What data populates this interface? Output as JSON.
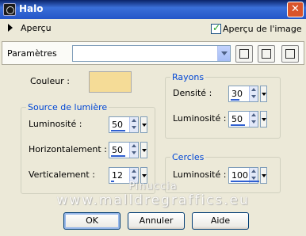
{
  "window": {
    "title": "Halo",
    "close_label": "✕"
  },
  "preview": {
    "label": "Aperçu",
    "image_preview_label": "Aperçu de l'image",
    "image_preview_checked": true
  },
  "params": {
    "label": "Paramètres",
    "preset_value": ""
  },
  "colour": {
    "label": "Couleur :",
    "value": "#f5dc97"
  },
  "light_source": {
    "legend": "Source de lumière",
    "brightness": {
      "label": "Luminosité :",
      "value": "50"
    },
    "horizontal": {
      "label": "Horizontalement :",
      "value": "50"
    },
    "vertical": {
      "label": "Verticalement :",
      "value": "12"
    }
  },
  "rays": {
    "legend": "Rayons",
    "density": {
      "label": "Densité :",
      "value": "30"
    },
    "brightness": {
      "label": "Luminosité :",
      "value": "50"
    }
  },
  "circles": {
    "legend": "Cercles",
    "brightness": {
      "label": "Luminosité :",
      "value": "100"
    }
  },
  "watermark": {
    "line1": "Pinuccia",
    "line2": "www.malldregraffics.eu"
  },
  "buttons": {
    "ok": "OK",
    "cancel": "Annuler",
    "help": "Aide"
  }
}
